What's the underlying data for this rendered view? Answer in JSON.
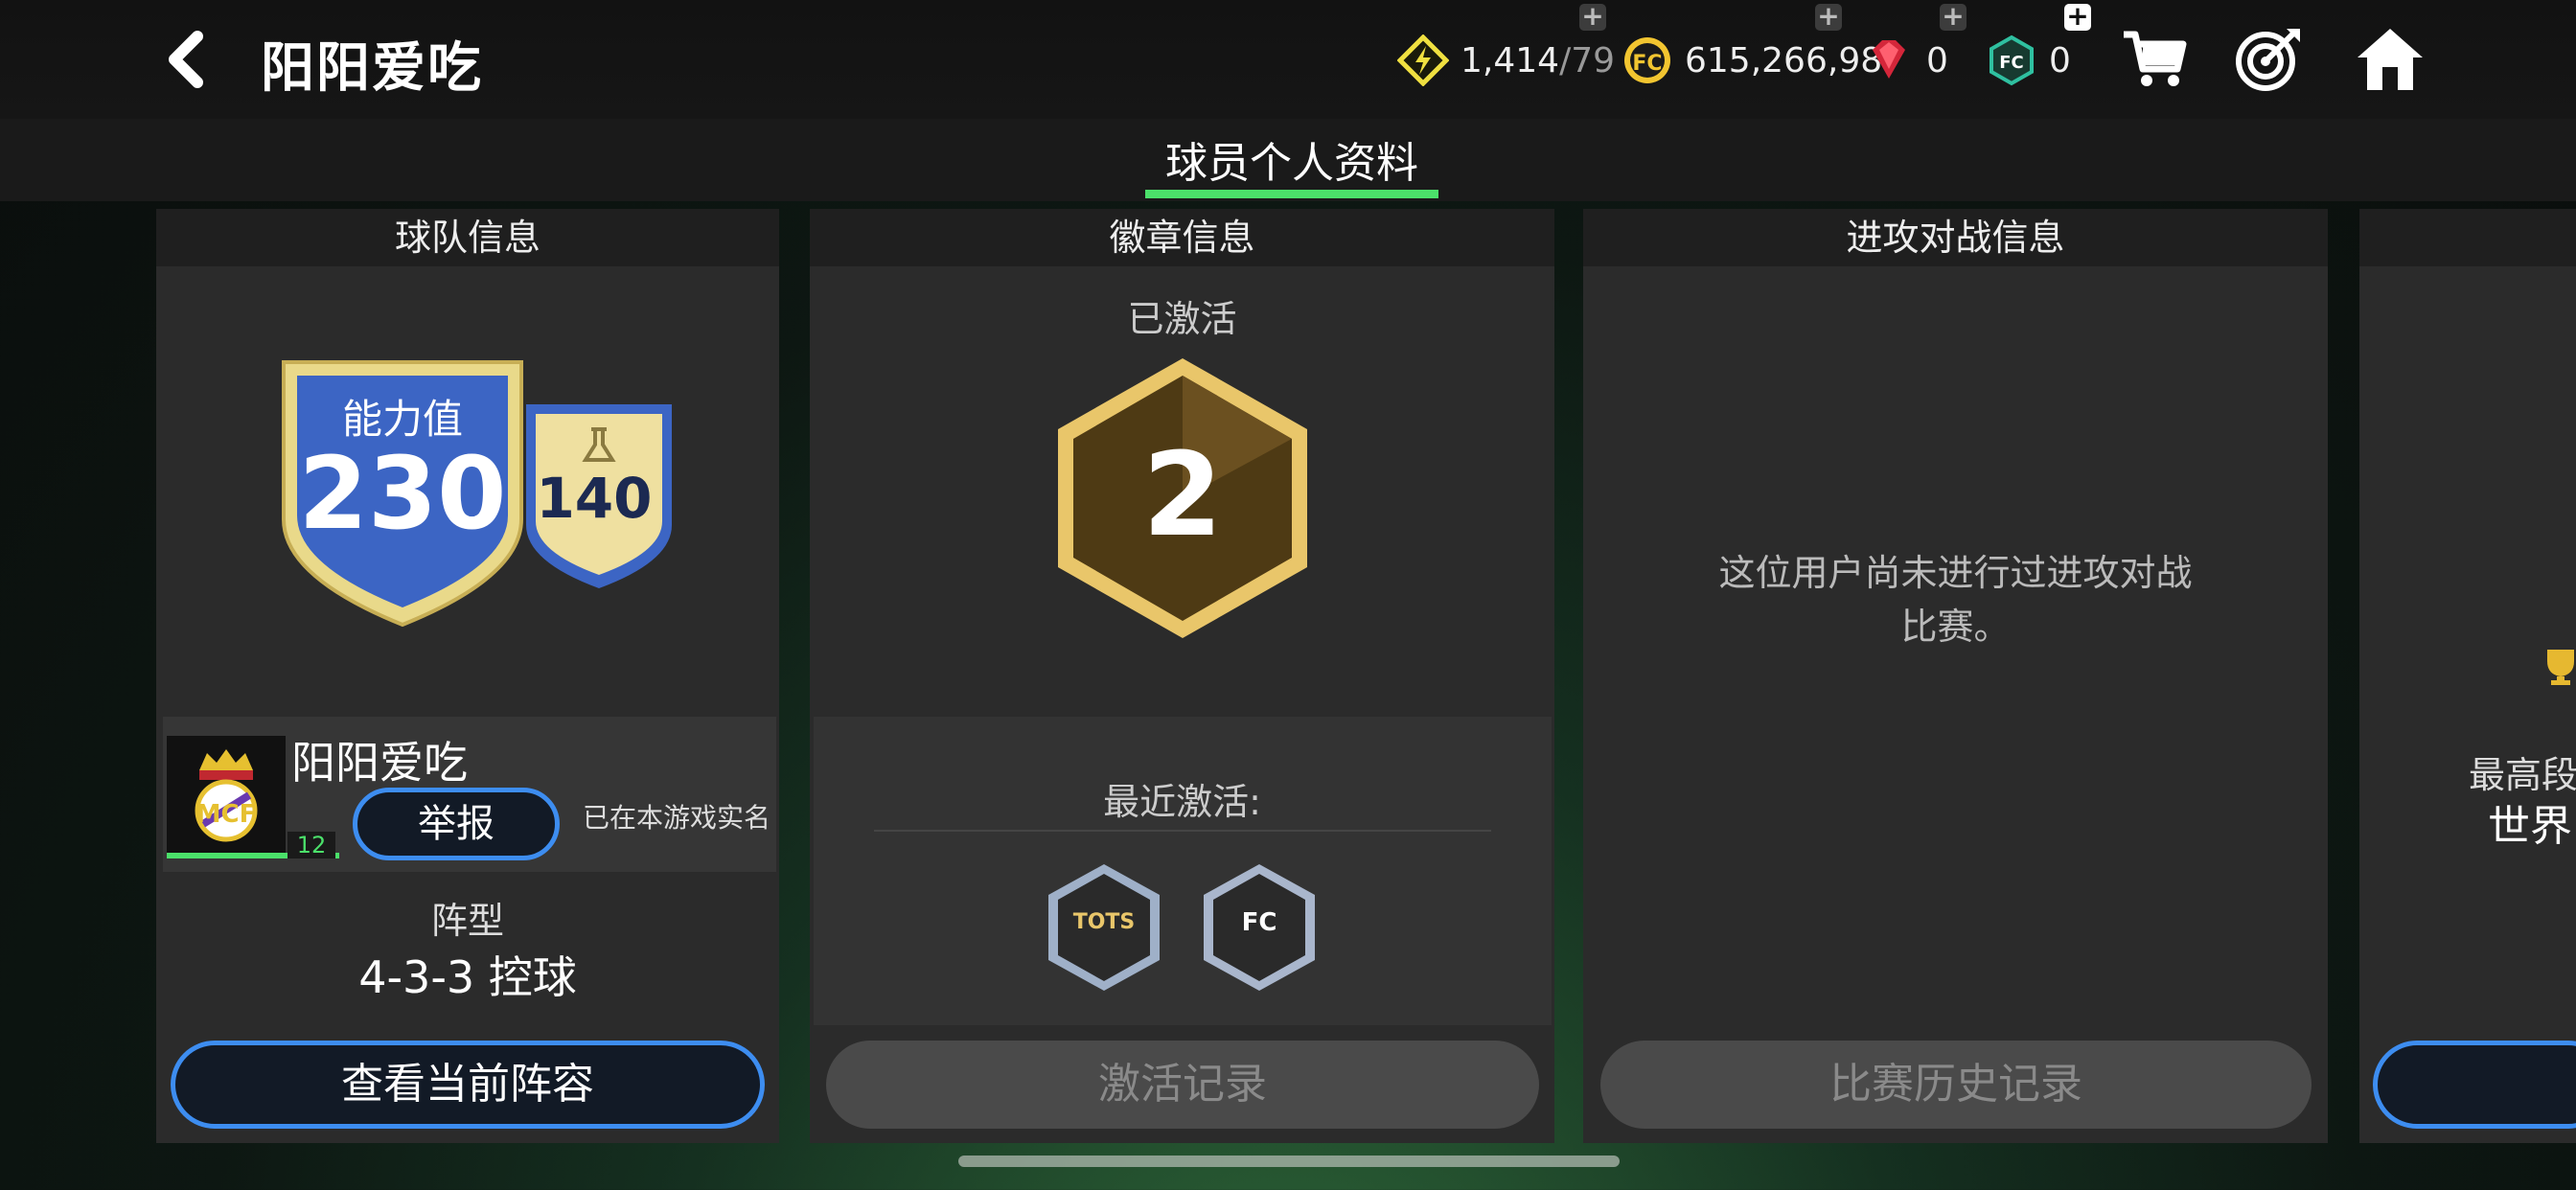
{
  "header": {
    "title": "阳阳爱吃",
    "energy": {
      "current": "1,414",
      "max": "/79"
    },
    "coins": "615,266,987",
    "gems": "0",
    "fc_points": "0"
  },
  "tabs": [
    {
      "label": "球员个人资料",
      "active": true
    }
  ],
  "team_panel": {
    "heading": "球队信息",
    "ability_label": "能力值",
    "ability_value": "230",
    "secondary_value": "140",
    "username": "阳阳爱吃",
    "level": "12",
    "report_button": "举报",
    "verified_text": "已在本游戏实名",
    "formation_label": "阵型",
    "formation_value": "4-3-3 控球",
    "view_lineup_button": "查看当前阵容"
  },
  "badge_panel": {
    "heading": "徽章信息",
    "activated_label": "已激活",
    "activated_count": "2",
    "recent_label": "最近激活:",
    "recent_badges": [
      "TOTS",
      "FC"
    ],
    "history_button": "激活记录"
  },
  "attack_panel": {
    "heading": "进攻对战信息",
    "empty_line1": "这位用户尚未进行过进攻对战",
    "empty_line2": "比赛。",
    "history_button": "比赛历史记录"
  },
  "partial_panel": {
    "highest_rank_label": "最高段",
    "rank_value": "世界"
  },
  "colors": {
    "accent_green": "#4be06a",
    "button_blue": "#3d8df0",
    "gold": "#e8c060"
  }
}
